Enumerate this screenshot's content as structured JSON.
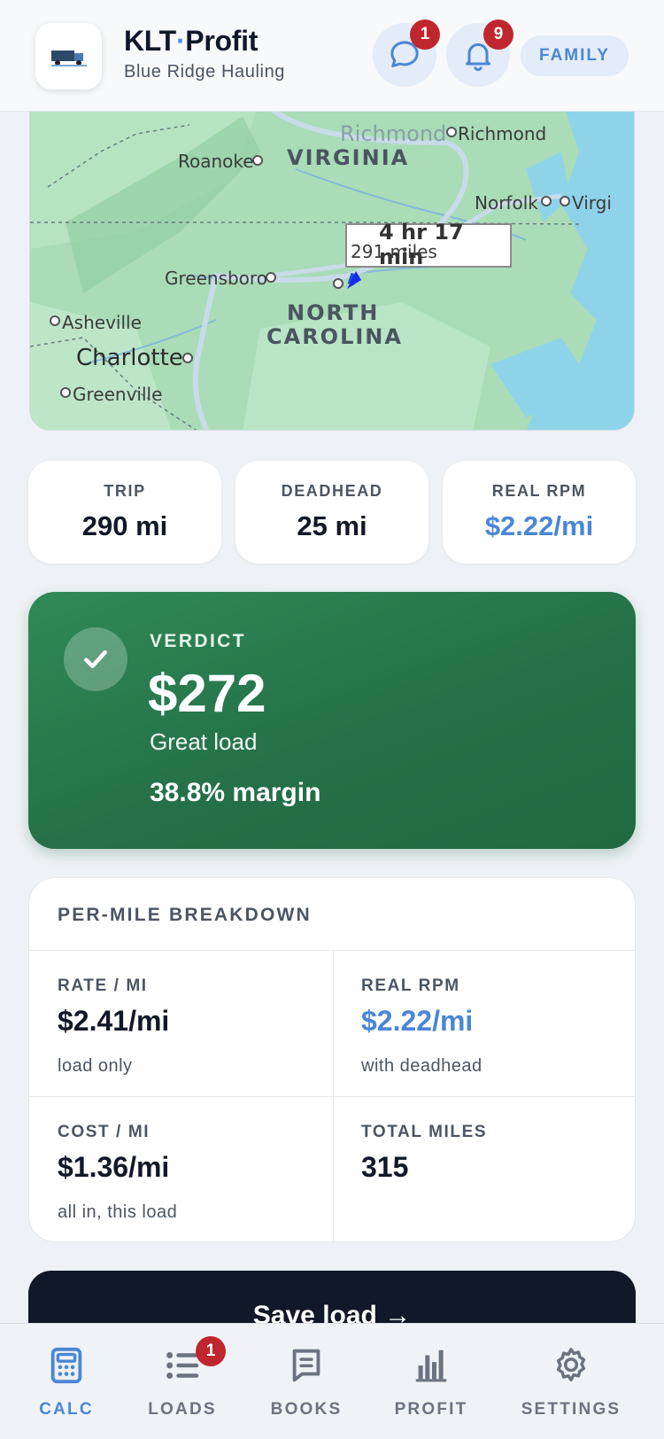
{
  "header": {
    "title_main": "KLT",
    "title_dot": "·",
    "title_rest": "Profit",
    "subtitle": "Blue Ridge Hauling",
    "messages_badge": "1",
    "notifications_badge": "9",
    "family_label": "FAMILY"
  },
  "map": {
    "states": [
      "VIRGINIA",
      "NORTH",
      "CAROLINA"
    ],
    "cities": {
      "richmond_faded": "Richmond",
      "richmond": "Richmond",
      "roanoke": "Roanoke",
      "norfolk": "Norfolk",
      "virginia_beach": "Virgi",
      "greensboro": "Greensboro",
      "asheville": "Asheville",
      "charlotte": "Charlotte",
      "greenville": "Greenville"
    },
    "route_time": "4 hr 17 min",
    "route_miles": "291 miles"
  },
  "stats": [
    {
      "label": "TRIP",
      "value": "290 mi"
    },
    {
      "label": "DEADHEAD",
      "value": "25 mi"
    },
    {
      "label": "REAL RPM",
      "value": "$2.22/mi"
    }
  ],
  "verdict": {
    "label": "VERDICT",
    "amount": "$272",
    "description": "Great load",
    "margin": "38.8% margin"
  },
  "breakdown": {
    "title": "PER-MILE BREAKDOWN",
    "cells": [
      {
        "label": "RATE / MI",
        "value": "$2.41/mi",
        "sub": "load only"
      },
      {
        "label": "REAL RPM",
        "value": "$2.22/mi",
        "sub": "with deadhead"
      },
      {
        "label": "COST / MI",
        "value": "$1.36/mi",
        "sub": "all in, this load"
      },
      {
        "label": "TOTAL MILES",
        "value": "315",
        "sub": ""
      }
    ]
  },
  "save_button": "Save load →",
  "nav": {
    "items": [
      {
        "label": "CALC",
        "icon": "calculator-icon",
        "active": true
      },
      {
        "label": "LOADS",
        "icon": "list-icon",
        "badge": "1"
      },
      {
        "label": "BOOKS",
        "icon": "book-icon"
      },
      {
        "label": "PROFIT",
        "icon": "bar-chart-icon"
      },
      {
        "label": "SETTINGS",
        "icon": "gear-icon"
      }
    ]
  },
  "colors": {
    "accent_blue": "#4a86d6",
    "verdict_green": "#257048",
    "badge_red": "#c0262d",
    "dark_button": "#111827"
  }
}
